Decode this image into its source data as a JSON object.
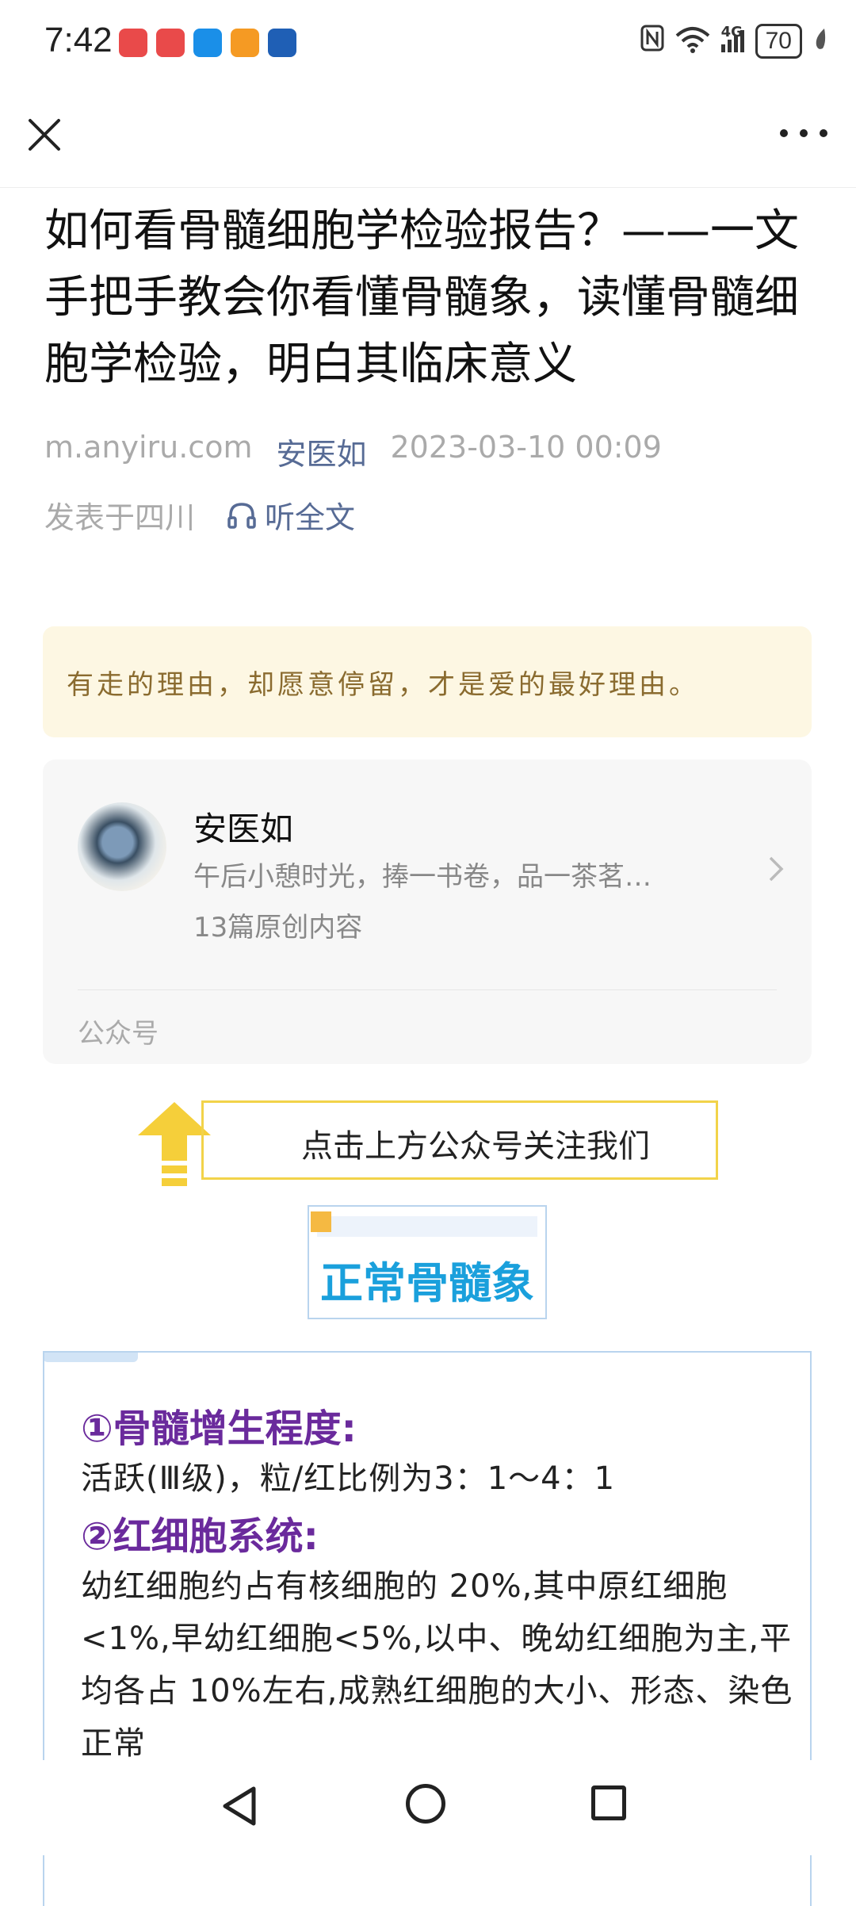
{
  "status_bar": {
    "time": "7:42",
    "network": "4G",
    "battery": "70",
    "app_icons": [
      "huawei-app-icon",
      "huawei-app-icon",
      "search-app-icon",
      "video-app-icon",
      "car-app-icon"
    ],
    "app_colors": [
      "#e94a4a",
      "#e94a4a",
      "#1a8fe8",
      "#f59a23",
      "#1f5fb5"
    ]
  },
  "nav": {
    "close_icon": "close-icon",
    "more_icon": "more-icon"
  },
  "article": {
    "title": "如何看骨髓细胞学检验报告？——一文手把手教会你看懂骨髓象，读懂骨髓细胞学检验，明白其临床意义",
    "domain": "m.anyiru.com",
    "account": "安医如",
    "date": "2023-03-10 00:09",
    "location": "发表于四川",
    "listen_label": "听全文"
  },
  "quote": {
    "text": "有走的理由，却愿意停留，才是爱的最好理由。"
  },
  "account_card": {
    "name": "安医如",
    "description": "午后小憩时光，捧一书卷，品一茶茗…",
    "count": "13篇原创内容",
    "type_label": "公众号"
  },
  "follow_banner": {
    "text": "点击上方公众号关注我们",
    "accent": "#f2d34a"
  },
  "section": {
    "title": "正常骨髓象",
    "title_color": "#1aa0dc"
  },
  "content": {
    "heading1": "①骨髓增生程度:",
    "text1": "活跃(Ⅲ级)，粒/红比例为3：1～4：1",
    "heading2": "②红细胞系统:",
    "text2": "幼红细胞约占有核细胞的 20%,其中原红细胞<1%,早幼红细胞<5%,以中、晚幼红细胞为主,平均各占 10%左右,成熟红细胞的大小、形态、染色正常",
    "heading_color": "#6a2a9c"
  },
  "system_nav": {
    "back_icon": "back-icon",
    "home_icon": "home-icon",
    "recent_icon": "recent-apps-icon"
  }
}
